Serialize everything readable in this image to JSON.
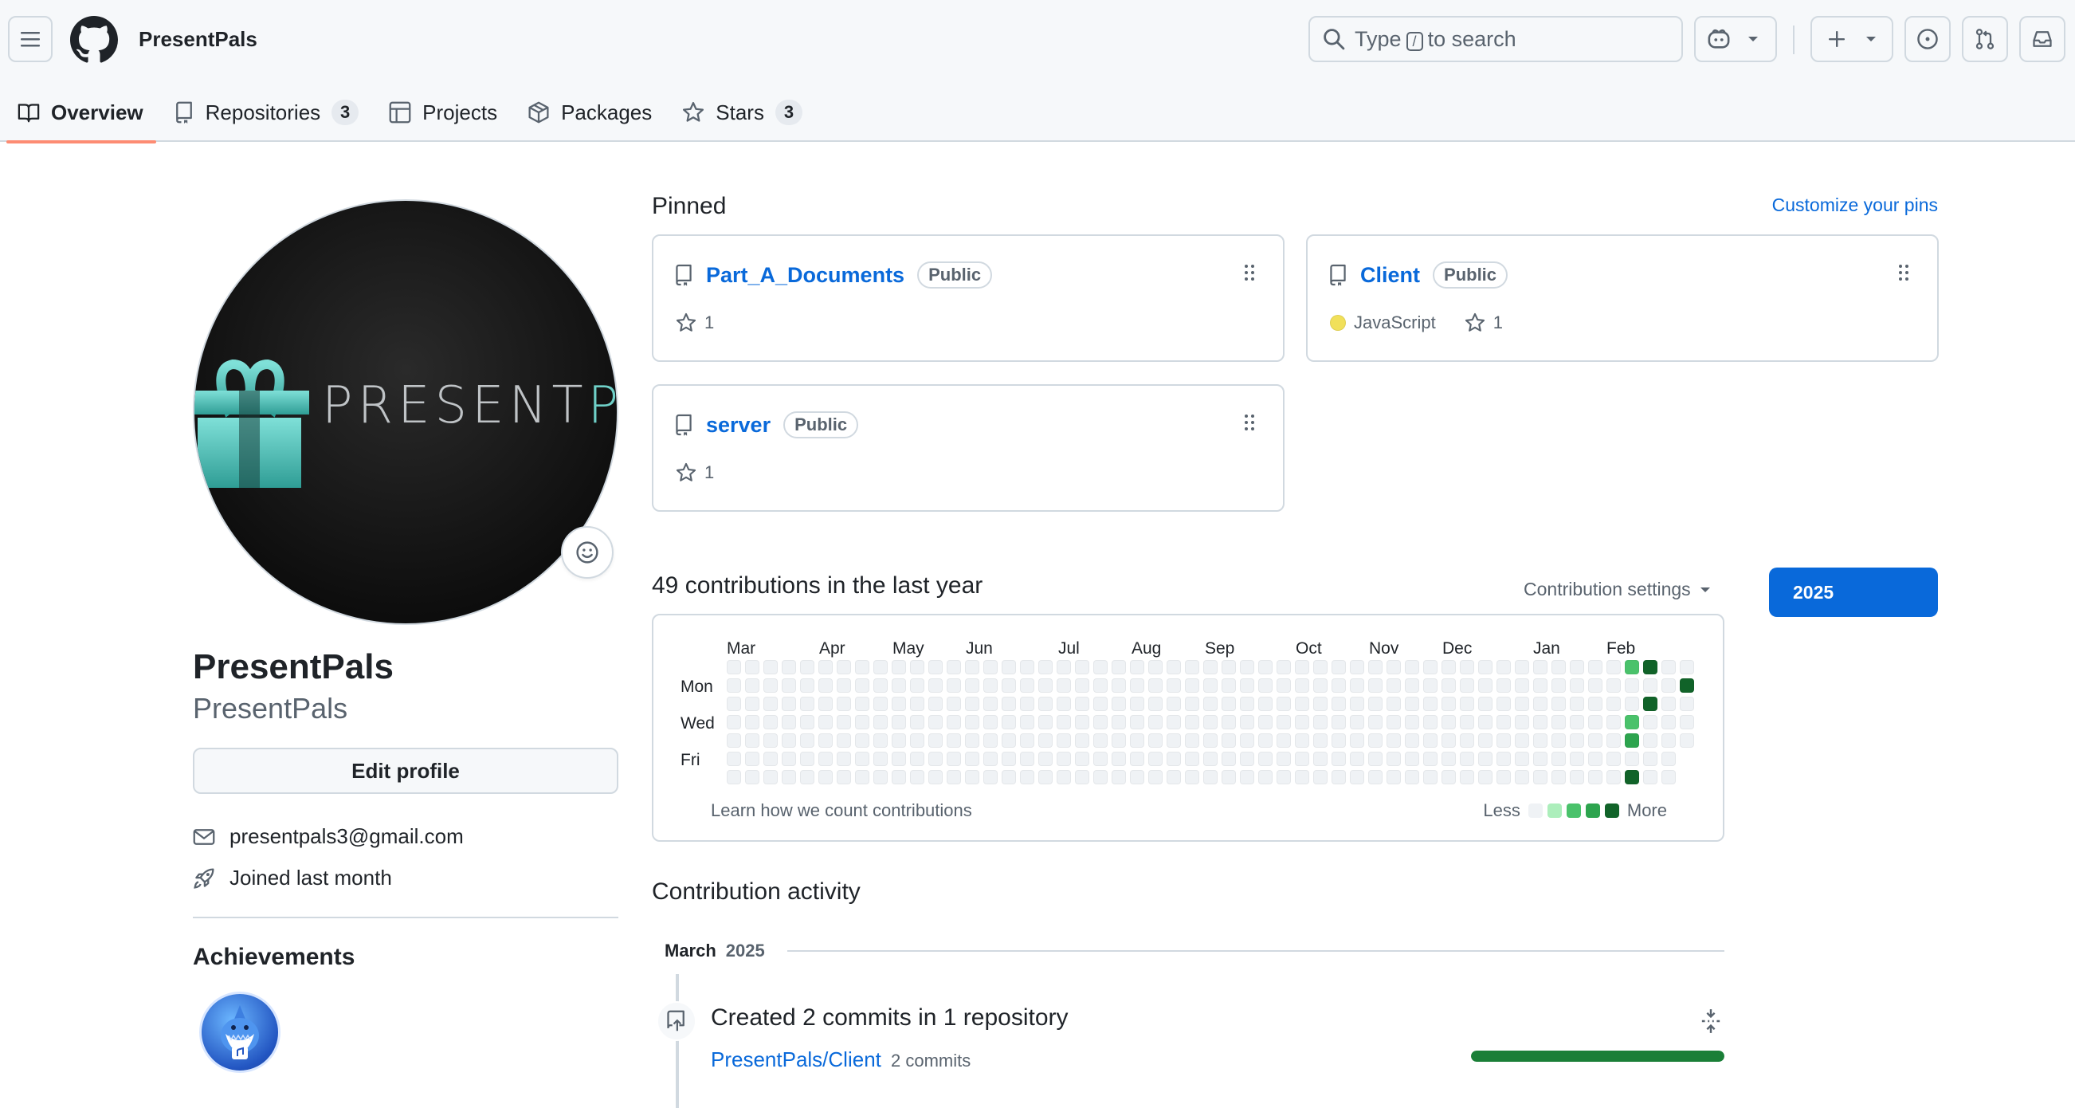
{
  "header": {
    "brand": "PresentPals",
    "search_prefix": "Type",
    "search_key": "/",
    "search_suffix": "to search"
  },
  "tabs": [
    {
      "label": "Overview",
      "icon": "book-icon",
      "active": true
    },
    {
      "label": "Repositories",
      "icon": "repo-icon",
      "count": "3"
    },
    {
      "label": "Projects",
      "icon": "table-icon"
    },
    {
      "label": "Packages",
      "icon": "package-icon"
    },
    {
      "label": "Stars",
      "icon": "star-icon",
      "count": "3"
    }
  ],
  "profile": {
    "avatar_text_left": "PRESENT",
    "avatar_text_right": "PALS",
    "name": "PresentPals",
    "login": "PresentPals",
    "edit_label": "Edit profile",
    "email": "presentpals3@gmail.com",
    "joined": "Joined last month",
    "achievements_title": "Achievements"
  },
  "pinned": {
    "title": "Pinned",
    "customize": "Customize your pins",
    "items": [
      {
        "name": "Part_A_Documents",
        "visibility": "Public",
        "stars": "1"
      },
      {
        "name": "Client",
        "visibility": "Public",
        "language": "JavaScript",
        "language_color": "#f1e05a",
        "stars": "1"
      },
      {
        "name": "server",
        "visibility": "Public",
        "stars": "1"
      }
    ]
  },
  "contributions": {
    "title": "49 contributions in the last year",
    "settings": "Contribution settings",
    "year": "2025",
    "months": [
      "Mar",
      "Apr",
      "May",
      "Jun",
      "Jul",
      "Aug",
      "Sep",
      "Oct",
      "Nov",
      "Dec",
      "Jan",
      "Feb"
    ],
    "days": [
      "Mon",
      "Wed",
      "Fri"
    ],
    "learn": "Learn how we count contributions",
    "less": "Less",
    "more": "More",
    "level_colors": [
      "#eff2f5",
      "#aceebb",
      "#4ac26b",
      "#2da44e",
      "#116329"
    ]
  },
  "activity": {
    "title": "Contribution activity",
    "month": "March",
    "year": "2025",
    "summary": "Created 2 commits in 1 repository",
    "repo": "PresentPals/Client",
    "commits": "2 commits",
    "share_fraction": 1.0
  }
}
